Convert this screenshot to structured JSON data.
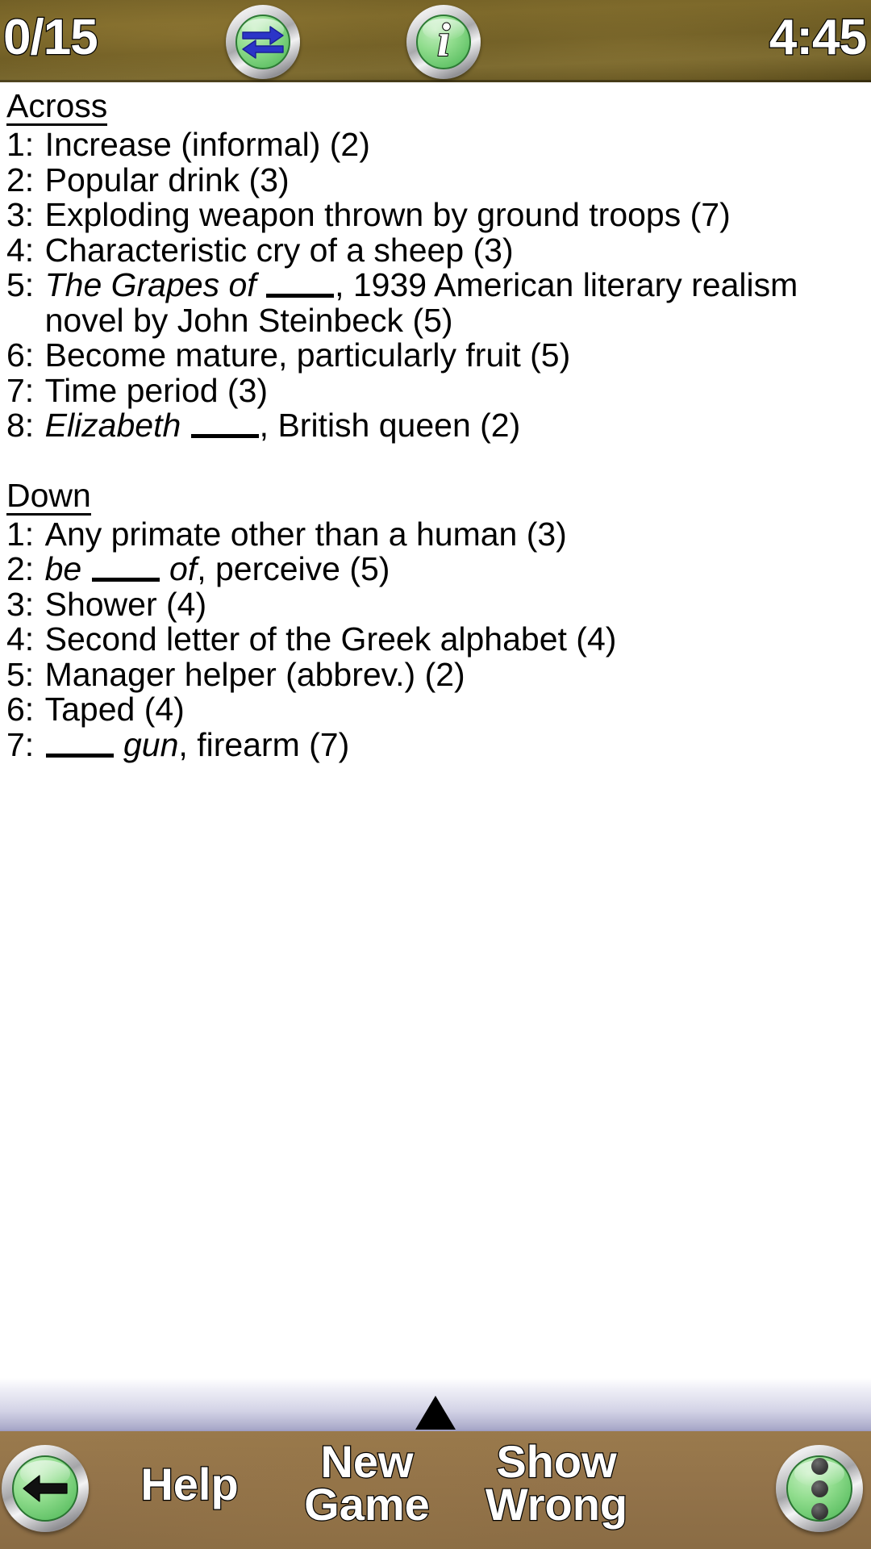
{
  "topbar": {
    "score": "0/15",
    "timer": "4:45",
    "swap_icon": "swap-arrows-icon",
    "info_icon": "info-icon",
    "info_glyph": "i"
  },
  "clues": {
    "across_heading": "Across",
    "down_heading": "Down",
    "across": [
      {
        "num": "1:",
        "segments": [
          {
            "text": "Increase (informal) (2)",
            "style": "normal"
          }
        ]
      },
      {
        "num": "2:",
        "segments": [
          {
            "text": "Popular drink (3)",
            "style": "normal"
          }
        ]
      },
      {
        "num": "3:",
        "segments": [
          {
            "text": "Exploding weapon thrown by ground troops (7)",
            "style": "normal"
          }
        ]
      },
      {
        "num": "4:",
        "segments": [
          {
            "text": "Characteristic cry of a sheep (3)",
            "style": "normal"
          }
        ]
      },
      {
        "num": "5:",
        "segments": [
          {
            "text": "The Grapes of ",
            "style": "italic"
          },
          {
            "text": "",
            "style": "blank"
          },
          {
            "text": ", 1939 American literary realism novel by John Steinbeck (5)",
            "style": "normal"
          }
        ]
      },
      {
        "num": "6:",
        "segments": [
          {
            "text": "Become mature, particularly fruit (5)",
            "style": "normal"
          }
        ]
      },
      {
        "num": "7:",
        "segments": [
          {
            "text": "Time period (3)",
            "style": "normal"
          }
        ]
      },
      {
        "num": "8:",
        "segments": [
          {
            "text": "Elizabeth ",
            "style": "italic"
          },
          {
            "text": "",
            "style": "blank"
          },
          {
            "text": ", British queen (2)",
            "style": "normal"
          }
        ]
      }
    ],
    "down": [
      {
        "num": "1:",
        "segments": [
          {
            "text": "Any primate other than a human (3)",
            "style": "normal"
          }
        ]
      },
      {
        "num": "2:",
        "segments": [
          {
            "text": "be ",
            "style": "italic"
          },
          {
            "text": "",
            "style": "blank"
          },
          {
            "text": " of",
            "style": "italic"
          },
          {
            "text": ", perceive (5)",
            "style": "normal"
          }
        ]
      },
      {
        "num": "3:",
        "segments": [
          {
            "text": "Shower (4)",
            "style": "normal"
          }
        ]
      },
      {
        "num": "4:",
        "segments": [
          {
            "text": "Second letter of the Greek alphabet (4)",
            "style": "normal"
          }
        ]
      },
      {
        "num": "5:",
        "segments": [
          {
            "text": "Manager helper (abbrev.) (2)",
            "style": "normal"
          }
        ]
      },
      {
        "num": "6:",
        "segments": [
          {
            "text": "Taped (4)",
            "style": "normal"
          }
        ]
      },
      {
        "num": "7:",
        "segments": [
          {
            "text": "",
            "style": "blank"
          },
          {
            "text": " gun",
            "style": "italic"
          },
          {
            "text": ", firearm (7)",
            "style": "normal"
          }
        ]
      }
    ]
  },
  "divider": {
    "collapse_icon": "triangle-up-icon"
  },
  "bottombar": {
    "back_icon": "arrow-left-icon",
    "menu_icon": "overflow-menu-dots-icon",
    "help_label": "Help",
    "new_game_label": "New\nGame",
    "show_wrong_label": "Show\nWrong"
  },
  "colors": {
    "topbar_brown": "#6e5c24",
    "bottombar_brown": "#93734a",
    "button_green": "#8fdc8c",
    "arrow_blue": "#2b35c8",
    "divider_lavender": "#a9a9c9",
    "text_white": "#ffffff",
    "text_black": "#000000"
  }
}
